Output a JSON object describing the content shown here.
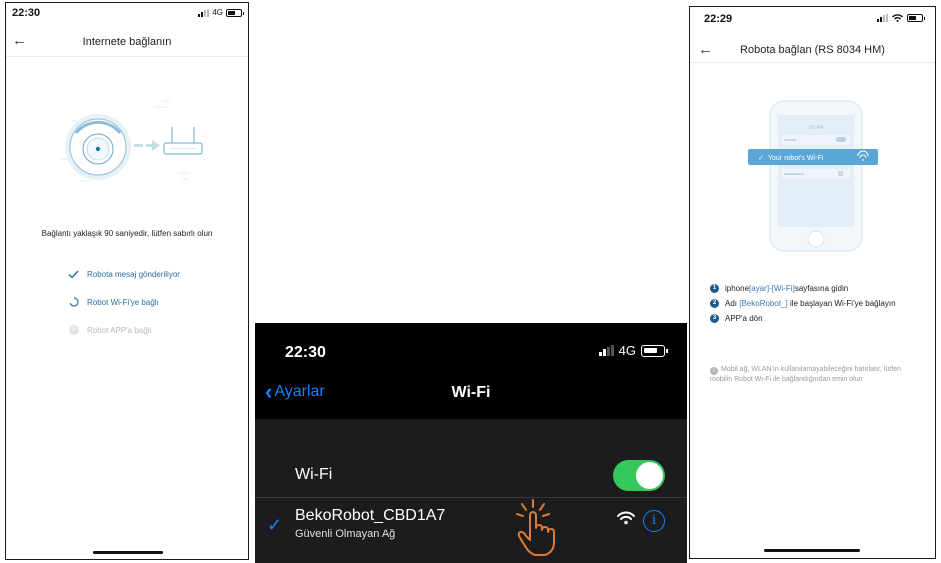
{
  "screen1": {
    "time": "22:30",
    "network": "4G",
    "title": "Internete bağlanın",
    "waiting_text": "Bağlantı yaklaşık 90 saniyedir, lütfen sabırlı olun",
    "steps": [
      {
        "label": "Robota mesaj gönderiliyor",
        "state": "done"
      },
      {
        "label": "Robot Wi-Fi'ye bağlı",
        "state": "active"
      },
      {
        "label": "Robot APP'a bağlı",
        "state": "pending",
        "number": "3"
      }
    ]
  },
  "screen2": {
    "time": "22:30",
    "network": "4G",
    "back_label": "Ayarlar",
    "title": "Wi-Fi",
    "wifi_label": "Wi-Fi",
    "wifi_on": true,
    "network_name": "BekoRobot_CBD1A7",
    "network_security": "Güvenli Olmayan Ağ",
    "info_glyph": "i",
    "colors": {
      "accent": "#0a84ff",
      "toggle_on": "#34c759"
    }
  },
  "screen3": {
    "time": "22:29",
    "title": "Robota bağlan (RS 8034 HM)",
    "illustration": {
      "header": "WLAN",
      "highlight": "Your robot's Wi-Fi"
    },
    "instructions": [
      {
        "num": "1",
        "pre": "iphone",
        "hl": "[ayar]-[Wi-Fi]",
        "post": "sayfasına gidin"
      },
      {
        "num": "2",
        "pre": "Adı ",
        "hl": "[BekoRobot_]",
        "post": " ile başlayan Wi-Fi'ye bağlayın"
      },
      {
        "num": "3",
        "pre": "APP'a dön",
        "hl": "",
        "post": ""
      }
    ],
    "note": "Mobil ağ, WLAN'ın kullanılamayabileceğini hatırlatır, lütfen mobilin Robot Wi-Fi ile bağlandığından emin olun",
    "colors": {
      "accent": "#1d5b8c",
      "highlight": "#3b7bb0"
    }
  }
}
